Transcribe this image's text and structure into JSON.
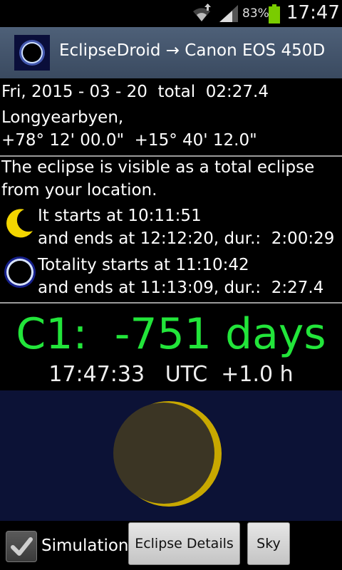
{
  "status": {
    "battery_percent": "83%",
    "time": "17:47"
  },
  "header": {
    "title": "EclipseDroid → Canon EOS 450D"
  },
  "event": {
    "date_line": "Fri, 2015 - 03 - 20  total  02:27.4",
    "location": "Longyearbyen,",
    "coordinates": "+78° 12' 00.0\"  +15° 40' 12.0\""
  },
  "visibility": {
    "line1": "The eclipse is visible as a total eclipse",
    "line2": "from your location."
  },
  "partial": {
    "start": "It starts at 10:11:51",
    "end": "and ends at 12:12:20, dur.:  2:00:29"
  },
  "totality": {
    "start": "Totality starts at 11:10:42",
    "end": "and ends at 11:13:09, dur.:  2:27.4"
  },
  "countdown": "C1:  -751 days",
  "clock": "17:47:33   UTC  +1.0 h",
  "controls": {
    "simulation_label": "Simulation",
    "simulation_checked": true,
    "details_button": "Eclipse Details",
    "sky_button": "Sky"
  },
  "colors": {
    "countdown": "#22e53a",
    "sky_background": "#0c1236",
    "sun": "#c8a800",
    "moon": "#3b3524"
  }
}
